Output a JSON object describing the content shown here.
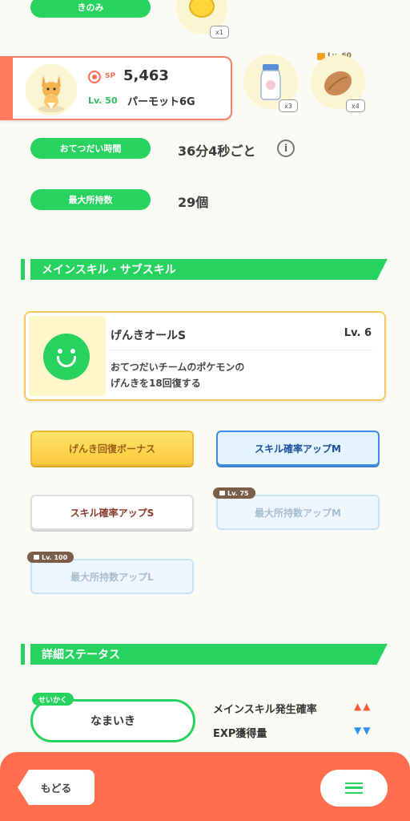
{
  "ingredients": {
    "berry_label": "きのみ",
    "berry_count": "x1",
    "items": [
      {
        "icon": "milk-bottle-icon",
        "count": "x3"
      },
      {
        "icon": "cacao-bean-icon",
        "count": "x4",
        "lock_level": "Lv. 60"
      }
    ]
  },
  "pokemon": {
    "sp_label": "SP",
    "sp_value": "5,463",
    "level": "Lv. 50",
    "name": "パーモット6G"
  },
  "help_time": {
    "label": "おてつだい時間",
    "value": "36分4秒ごと",
    "info_icon": "i"
  },
  "max_carry": {
    "label": "最大所持数",
    "value": "29個"
  },
  "skills_section": {
    "title": "メインスキル・サブスキル"
  },
  "main_skill": {
    "name": "げんきオールS",
    "level": "Lv. 6",
    "description_line1": "おてつだいチームのポケモンの",
    "description_line2": "げんきを18回復する"
  },
  "sub_skills": [
    {
      "label": "げんき回復ボーナス",
      "style": "gold"
    },
    {
      "label": "スキル確率アップM",
      "style": "blue"
    },
    {
      "label": "スキル確率アップS",
      "style": "white"
    },
    {
      "label": "最大所持数アップM",
      "style": "locked",
      "lock_level": "Lv. 75"
    },
    {
      "label": "最大所持数アップL",
      "style": "locked",
      "lock_level": "Lv. 100"
    }
  ],
  "details_section": {
    "title": "詳細ステータス"
  },
  "nature": {
    "tag": "せいかく",
    "value": "なまいき",
    "up_stat": "メインスキル発生確率",
    "up_arrows": "▲▲",
    "down_stat": "EXP獲得量",
    "down_arrows": "▼▼"
  },
  "bottom_nav": {
    "back_label": "もどる",
    "menu_icon": "hamburger-menu-icon"
  },
  "colors": {
    "accent_green": "#28d25f",
    "bottom_bar": "#ff6f4f",
    "up_arrow": "#ff5a3c",
    "down_arrow": "#2f8ff0"
  }
}
